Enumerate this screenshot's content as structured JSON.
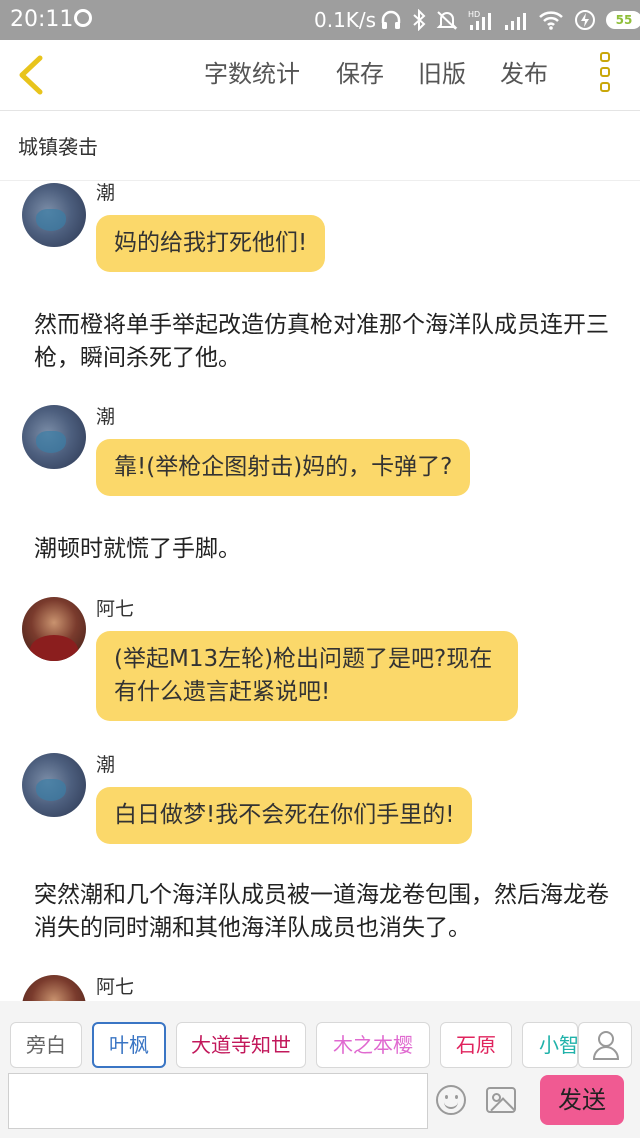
{
  "status_bar": {
    "time": "20:11",
    "network_speed": "0.1K/s",
    "battery": "55",
    "icons": [
      "app-icon",
      "headphones-icon",
      "bluetooth-icon",
      "mute-alarm-icon",
      "hd-signal-icon",
      "signal-icon",
      "wifi-icon",
      "charging-icon",
      "battery-icon"
    ]
  },
  "toolbar": {
    "back_icon": "chevron-left-icon",
    "word_count": "字数统计",
    "save": "保存",
    "old_version": "旧版",
    "publish": "发布",
    "menu_icon": "more-vertical-icon",
    "accent_color": "#e8c41c"
  },
  "story": {
    "title": "城镇袭击"
  },
  "messages": [
    {
      "type": "dialog",
      "speaker": "潮",
      "text": "妈的给我打死他们!"
    },
    {
      "type": "narration",
      "text": "然而橙将单手举起改造仿真枪对准那个海洋队成员连开三枪，瞬间杀死了他。"
    },
    {
      "type": "dialog",
      "speaker": "潮",
      "text": "靠!(举枪企图射击)妈的，卡弹了?"
    },
    {
      "type": "narration",
      "text": "潮顿时就慌了手脚。"
    },
    {
      "type": "dialog",
      "speaker": "阿七",
      "text": "(举起M13左轮)枪出问题了是吧?现在有什么遗言赶紧说吧!"
    },
    {
      "type": "dialog",
      "speaker": "潮",
      "text": "白日做梦!我不会死在你们手里的!"
    },
    {
      "type": "narration",
      "text": "突然潮和几个海洋队成员被一道海龙卷包围，然后海龙卷消失的同时潮和其他海洋队成员也消失了。"
    },
    {
      "type": "dialog",
      "speaker": "阿七",
      "text": ""
    }
  ],
  "characters": [
    {
      "name": "旁白",
      "color": "#666666",
      "selected": false
    },
    {
      "name": "叶枫",
      "color": "#3a75c4",
      "selected": true
    },
    {
      "name": "大道寺知世",
      "color": "#c2185b",
      "selected": false
    },
    {
      "name": "木之本樱",
      "color": "#e06ad0",
      "selected": false
    },
    {
      "name": "石原",
      "color": "#e0245e",
      "selected": false
    },
    {
      "name": "小智",
      "color": "#20b2aa",
      "selected": false
    }
  ],
  "input": {
    "value": "",
    "placeholder": "",
    "send_label": "发送",
    "emoji_icon": "emoji-icon",
    "image_icon": "image-icon",
    "send_color": "#f05a92"
  },
  "bubble_color": "#fbd86a"
}
